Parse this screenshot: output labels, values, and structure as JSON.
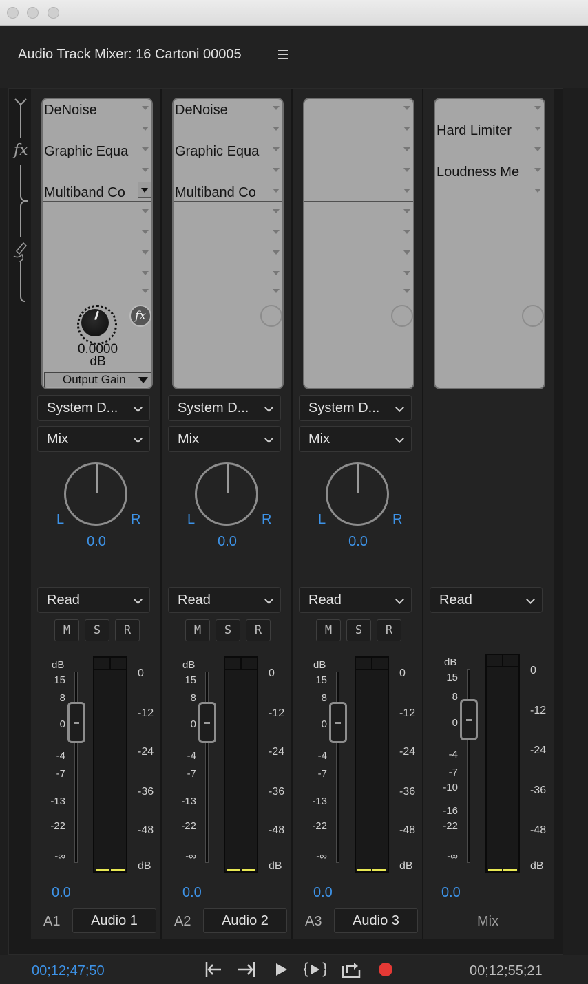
{
  "window": {
    "buttons": [
      "close",
      "minimize",
      "zoom"
    ]
  },
  "panel": {
    "title": "Audio Track Mixer: 16 Cartoni 00005",
    "menu_icon": "hamburger-menu-icon"
  },
  "rail": {
    "fx_label": "fx",
    "send_icon": "send-pen-icon"
  },
  "tracks": [
    {
      "id": "A1",
      "name": "Audio 1",
      "effects": [
        "DeNoise",
        "",
        "Graphic Equa",
        "",
        "Multiband Co"
      ],
      "gain_value": "0.0000",
      "gain_unit": "dB",
      "gain_param": "Output Gain",
      "output": "System D...",
      "send": "Mix",
      "pan_l": "L",
      "pan_r": "R",
      "pan_value": "0.0",
      "automation": "Read",
      "mute": "M",
      "solo": "S",
      "record": "R",
      "volume": "0.0"
    },
    {
      "id": "A2",
      "name": "Audio 2",
      "effects": [
        "DeNoise",
        "",
        "Graphic Equa",
        "",
        "Multiband Co"
      ],
      "output": "System D...",
      "send": "Mix",
      "pan_l": "L",
      "pan_r": "R",
      "pan_value": "0.0",
      "automation": "Read",
      "mute": "M",
      "solo": "S",
      "record": "R",
      "volume": "0.0"
    },
    {
      "id": "A3",
      "name": "Audio 3",
      "effects": [
        "",
        "",
        "",
        "",
        ""
      ],
      "output": "System D...",
      "send": "Mix",
      "pan_l": "L",
      "pan_r": "R",
      "pan_value": "0.0",
      "automation": "Read",
      "mute": "M",
      "solo": "S",
      "record": "R",
      "volume": "0.0"
    }
  ],
  "master": {
    "name": "Mix",
    "effects": [
      "",
      "Hard Limiter",
      "",
      "Loudness Me",
      ""
    ],
    "automation": "Read",
    "volume": "0.0"
  },
  "fader_scale": {
    "header": "dB",
    "track_marks": [
      "15",
      "8",
      "0",
      "-4",
      "-7",
      "-13",
      "-22",
      "-∞"
    ],
    "master_marks": [
      "15",
      "8",
      "0",
      "-4",
      "-7",
      "-10",
      "-16",
      "-22",
      "-∞"
    ]
  },
  "meter_scale": {
    "marks": [
      "0",
      "-12",
      "-24",
      "-36",
      "-48",
      "dB"
    ]
  },
  "transport": {
    "current_time": "00;12;47;50",
    "duration": "00;12;55;21",
    "buttons": [
      "go-to-in-icon",
      "go-to-out-icon",
      "play-icon",
      "play-in-to-out-icon",
      "loop-icon",
      "record-icon"
    ]
  },
  "colors": {
    "accent": "#3d93e8",
    "record": "#e53935",
    "meter_level": "#e8e853",
    "rack": "#a6a6a6"
  }
}
